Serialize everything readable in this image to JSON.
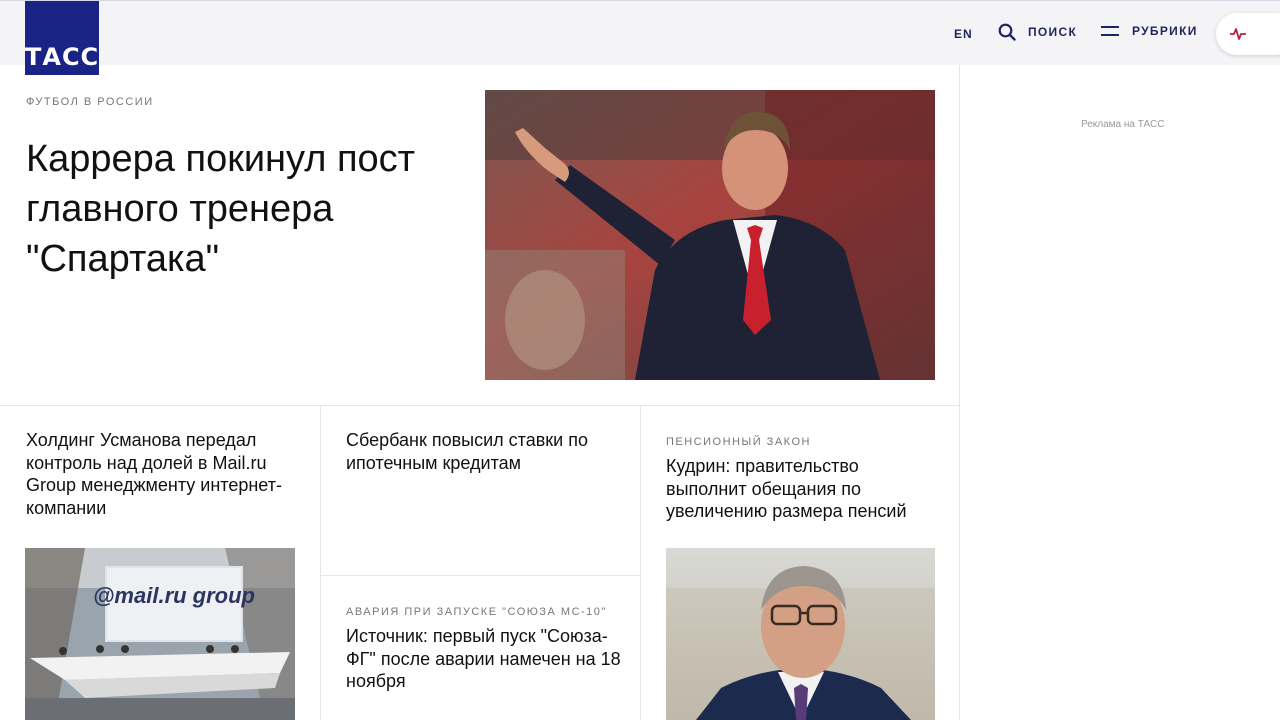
{
  "header": {
    "logo_text": "ТАСС",
    "lang": "EN",
    "search_label": "ПОИСК",
    "rubrics_label": "РУБРИКИ",
    "icons": {
      "search": "search-icon",
      "menu": "menu-icon",
      "live": "pulse-icon"
    },
    "colors": {
      "brand": "#1a2487",
      "nav_text": "#1f245f",
      "live_accent": "#b8233f"
    }
  },
  "top_story": {
    "rubric": "ФУТБОЛ В РОССИИ",
    "title": "Каррера покинул пост главного тренера \"Спартака\""
  },
  "sidebar": {
    "ad_label": "Реклама на ТАСС"
  },
  "cards": [
    {
      "title": "Холдинг Усманова передал контроль над долей в Mail.ru Group менеджменту интернет-компании"
    },
    {
      "title": "Сбербанк повысил ставки по ипотечным кредитам"
    },
    {
      "rubric": "АВАРИЯ ПРИ ЗАПУСКЕ \"СОЮЗА МС-10\"",
      "title": "Источник: первый пуск \"Союза-ФГ\" после аварии намечен на 18 ноября"
    },
    {
      "rubric": "ПЕНСИОННЫЙ ЗАКОН",
      "title": "Кудрин: правительство выполнит обещания по увеличению размера пенсий"
    }
  ],
  "images": {
    "mailru_screen_text": "@mail.ru group"
  }
}
